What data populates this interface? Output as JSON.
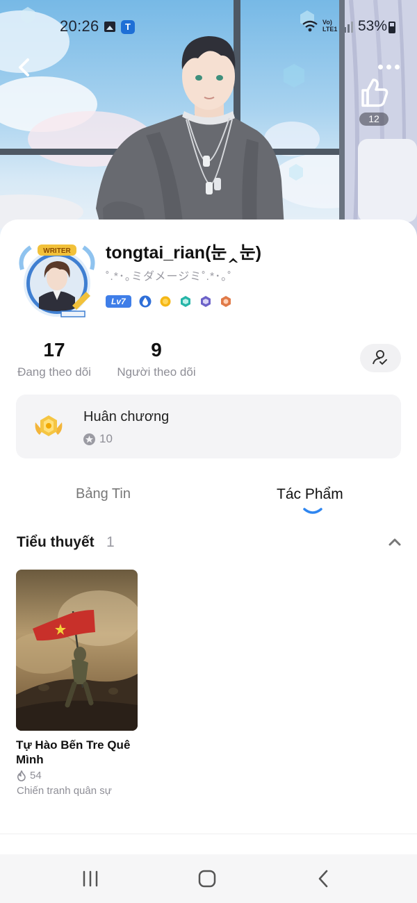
{
  "status_bar": {
    "time": "20:26",
    "network": "Vo) LTE1",
    "battery": "53%"
  },
  "header": {
    "like_count": "12"
  },
  "profile": {
    "username": "tongtai_rian(눈‸눈)",
    "bio": "˚.*･｡ミダメージミ˚.*･｡˚",
    "level": "Lv7",
    "avatar_badge": "WRITER"
  },
  "stats": {
    "following": {
      "value": "17",
      "label": "Đang theo dõi"
    },
    "followers": {
      "value": "9",
      "label": "Người theo dõi"
    }
  },
  "medals": {
    "title": "Huân chương",
    "count": "10"
  },
  "tabs": {
    "feed": "Bảng Tin",
    "works": "Tác Phẩm",
    "active": "works"
  },
  "section": {
    "title": "Tiểu thuyết",
    "count": "1"
  },
  "novels": [
    {
      "title": "Tự Hào Bến Tre Quê Mình",
      "views": "54",
      "genre": "Chiến tranh quân sự"
    }
  ],
  "colors": {
    "accent": "#3f7ee8",
    "tab_indicator": "#2f86f0",
    "muted": "#8e8e96"
  }
}
